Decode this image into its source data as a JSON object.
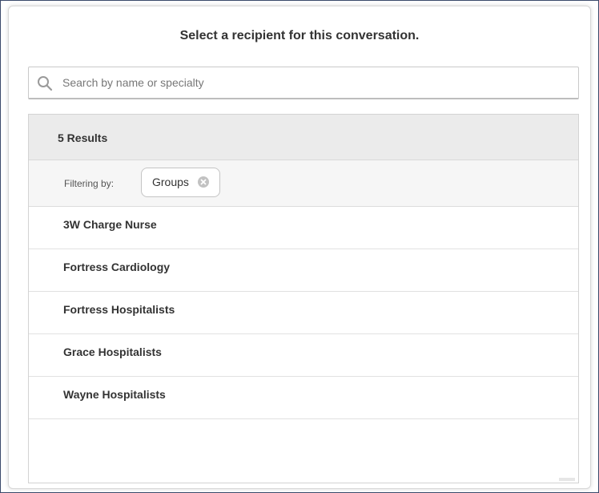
{
  "dialog": {
    "title": "Select a recipient for this conversation."
  },
  "search": {
    "placeholder": "Search by name or specialty",
    "value": ""
  },
  "results": {
    "count_label": "5 Results",
    "filter_label": "Filtering by:",
    "filter_chip": "Groups",
    "items": [
      {
        "label": "3W Charge Nurse"
      },
      {
        "label": "Fortress Cardiology"
      },
      {
        "label": "Fortress Hospitalists"
      },
      {
        "label": "Grace Hospitalists"
      },
      {
        "label": "Wayne Hospitalists"
      }
    ]
  },
  "icons": {
    "search": "search-icon",
    "chip_close": "close-circle-icon"
  },
  "colors": {
    "header_bg": "#ebebeb",
    "filter_bg": "#f6f6f6",
    "text": "#333333"
  }
}
